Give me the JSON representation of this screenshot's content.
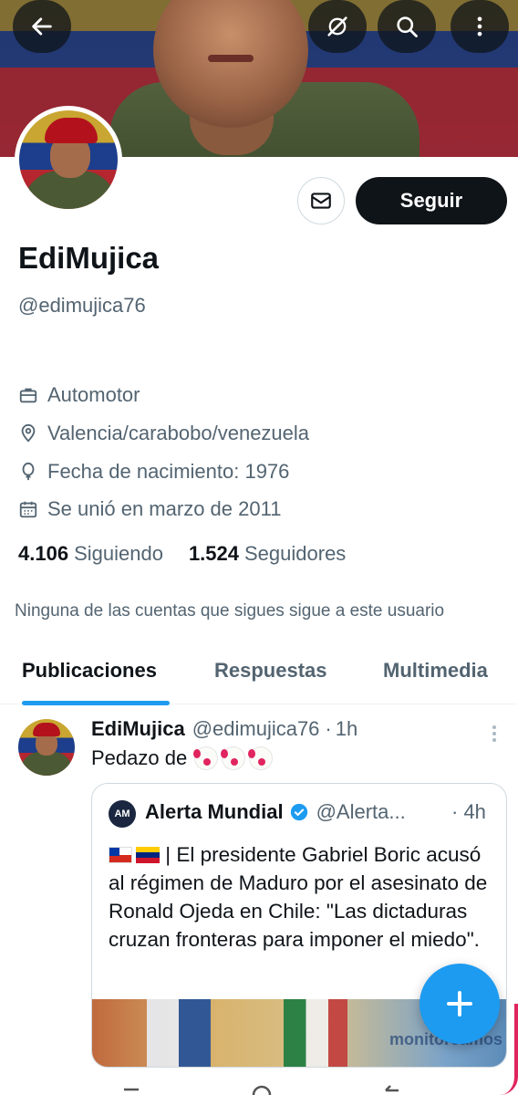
{
  "profile": {
    "name": "EdiMujica",
    "handle": "@edimujica76",
    "follow_label": "Seguir",
    "job": "Automotor",
    "location": "Valencia/carabobo/venezuela",
    "birth": "Fecha de nacimiento: 1976",
    "joined": "Se unió en marzo de 2011",
    "following_count": "4.106",
    "following_label": "Siguiendo",
    "followers_count": "1.524",
    "followers_label": "Seguidores",
    "mutuals_note": "Ninguna de las cuentas que sigues sigue a este usuario"
  },
  "tabs": [
    {
      "label": "Publicaciones",
      "active": true
    },
    {
      "label": "Respuestas",
      "active": false
    },
    {
      "label": "Multimedia",
      "active": false
    }
  ],
  "post": {
    "author": "EdiMujica",
    "handle": "@edimujica76",
    "dot": "·",
    "time": "1h",
    "text": "Pedazo de",
    "emoji": [
      "clown-face",
      "clown-face",
      "clown-face"
    ],
    "quote": {
      "author": "Alerta Mundial",
      "handle": "@Alerta...",
      "time": "· 4h",
      "logo_text": "AM",
      "text": "| El presidente Gabriel Boric acusó al régimen de Maduro por el asesinato de Ronald Ojeda en Chile: \"Las dictaduras cruzan fronteras para imponer el miedo\".",
      "flags": [
        "flag-chile",
        "flag-venezuela"
      ],
      "media_watermark": "monitoreamos"
    }
  },
  "icons": {
    "back": "arrow-left-icon",
    "grok": "grok-icon",
    "search": "search-icon",
    "more": "more-vertical-icon",
    "message": "envelope-icon",
    "job": "briefcase-icon",
    "location": "location-pin-icon",
    "birth": "balloon-icon",
    "joined": "calendar-icon",
    "verified": "verified-badge-icon",
    "compose": "plus-icon"
  },
  "colors": {
    "accent": "#1d9bf0",
    "text": "#0f1419",
    "secondary": "#536471",
    "button_dark": "#0f1419"
  }
}
